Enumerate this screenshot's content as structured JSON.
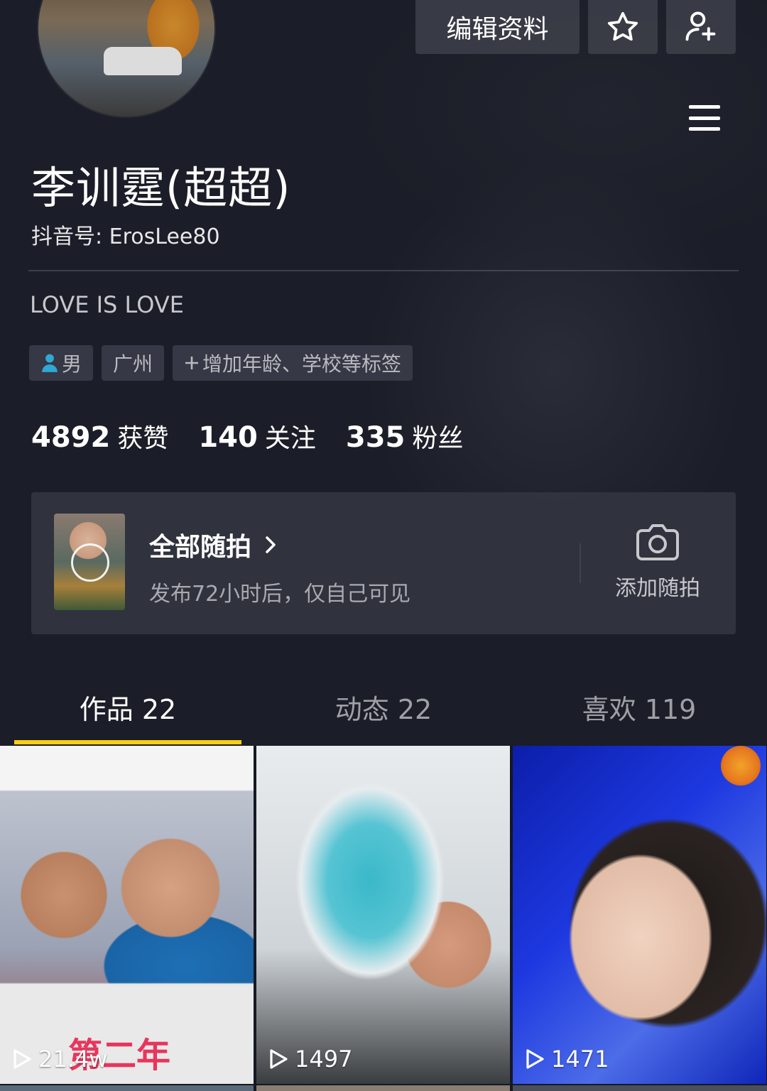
{
  "header": {
    "edit_profile_label": "编辑资料",
    "icons": [
      "star-icon",
      "add-friend-icon",
      "menu-icon"
    ]
  },
  "profile": {
    "nickname": "李训霆(超超)",
    "douyin_id": "抖音号: ErosLee80",
    "signature": "LOVE IS LOVE",
    "tags": {
      "gender": "男",
      "city": "广州",
      "add_tag": "增加年龄、学校等标签"
    },
    "stats": [
      {
        "num": "4892",
        "label": "获赞"
      },
      {
        "num": "140",
        "label": "关注"
      },
      {
        "num": "335",
        "label": "粉丝"
      }
    ]
  },
  "story": {
    "title": "全部随拍",
    "subtitle": "发布72小时后，仅自己可见",
    "add_label": "添加随拍"
  },
  "tabs": [
    {
      "label": "作品 22",
      "active": true
    },
    {
      "label": "动态 22",
      "active": false
    },
    {
      "label": "喜欢 119",
      "active": false
    }
  ],
  "videos": [
    {
      "plays": "21.4w",
      "caption": "第二年"
    },
    {
      "plays": "1497"
    },
    {
      "plays": "1471"
    }
  ],
  "colors": {
    "background": "#161823",
    "accent_yellow": "#face15",
    "gender_blue": "#2fa8d6",
    "caption_pink": "#e7365c"
  }
}
